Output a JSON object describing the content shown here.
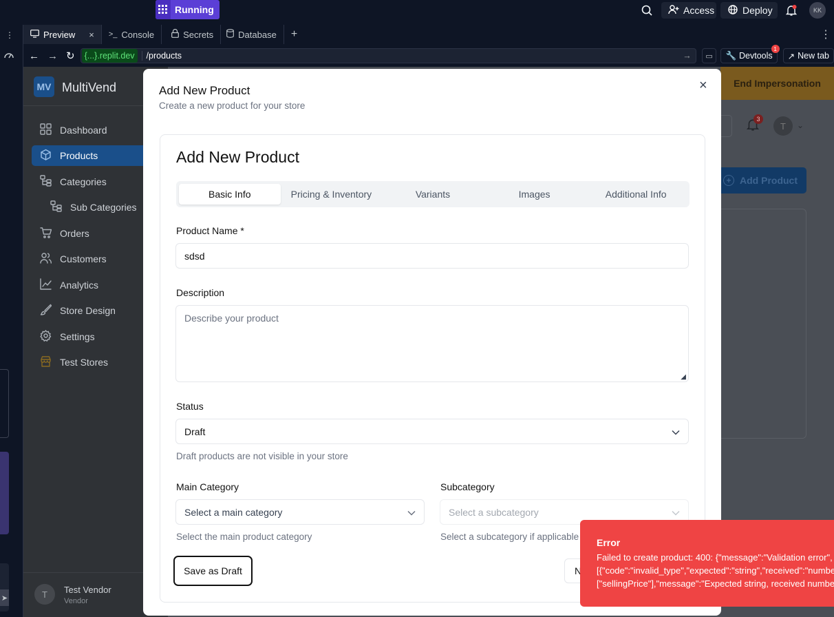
{
  "topbar": {
    "run_label": "Running",
    "access_label": "Access",
    "deploy_label": "Deploy",
    "avatar_initials": "KK"
  },
  "tabs": [
    {
      "label": "Preview",
      "icon": "monitor-icon"
    },
    {
      "label": "Console",
      "icon": "terminal-icon"
    },
    {
      "label": "Secrets",
      "icon": "lock-icon"
    },
    {
      "label": "Database",
      "icon": "database-icon"
    }
  ],
  "urlbar": {
    "domain": "{...}.replit.dev",
    "path": "/products",
    "devtools_label": "Devtools",
    "devtools_badge": "1",
    "newtab_label": "New tab"
  },
  "app": {
    "logo": "MV",
    "brand": "MultiVend",
    "nav": [
      {
        "label": "Dashboard",
        "icon": "dashboard-icon"
      },
      {
        "label": "Products",
        "icon": "box-icon"
      },
      {
        "label": "Categories",
        "icon": "categories-icon"
      },
      {
        "label": "Sub Categories",
        "icon": "subcategories-icon"
      },
      {
        "label": "Orders",
        "icon": "cart-icon"
      },
      {
        "label": "Customers",
        "icon": "users-icon"
      },
      {
        "label": "Analytics",
        "icon": "chart-icon"
      },
      {
        "label": "Store Design",
        "icon": "brush-icon"
      },
      {
        "label": "Settings",
        "icon": "gear-icon"
      },
      {
        "label": "Test Stores",
        "icon": "store-icon"
      }
    ],
    "end_impersonation": "End Impersonation",
    "notif_count": "3",
    "user_initial": "T",
    "add_product": "Add Product",
    "vendor_initial": "T",
    "vendor_name": "Test Vendor",
    "vendor_role": "Vendor"
  },
  "modal": {
    "title": "Add New Product",
    "subtitle": "Create a new product for your store",
    "card_title": "Add New Product",
    "tabs": [
      "Basic Info",
      "Pricing & Inventory",
      "Variants",
      "Images",
      "Additional Info"
    ],
    "name_label": "Product Name *",
    "name_value": "sdsd",
    "desc_label": "Description",
    "desc_placeholder": "Describe your product",
    "status_label": "Status",
    "status_value": "Draft",
    "status_hint": "Draft products are not visible in your store",
    "main_cat_label": "Main Category",
    "main_cat_placeholder": "Select a main category",
    "main_cat_hint": "Select the main product category",
    "sub_cat_label": "Subcategory",
    "sub_cat_placeholder": "Select a subcategory",
    "sub_cat_hint": "Select a subcategory if applicable",
    "save_draft": "Save as Draft",
    "next_partial": "N"
  },
  "toast": {
    "title": "Error",
    "line1": "Failed to create product: 400: {\"message\":\"Validation error\",",
    "line2": "[{\"code\":\"invalid_type\",\"expected\":\"string\",\"received\":\"number\"",
    "line3": "[\"sellingPrice\"],\"message\":\"Expected string, received number"
  },
  "colors": {
    "accent": "#5b3fd6",
    "nav_active": "#1a4f8a",
    "impersonation": "#d89a1a",
    "error": "#ef4444"
  }
}
